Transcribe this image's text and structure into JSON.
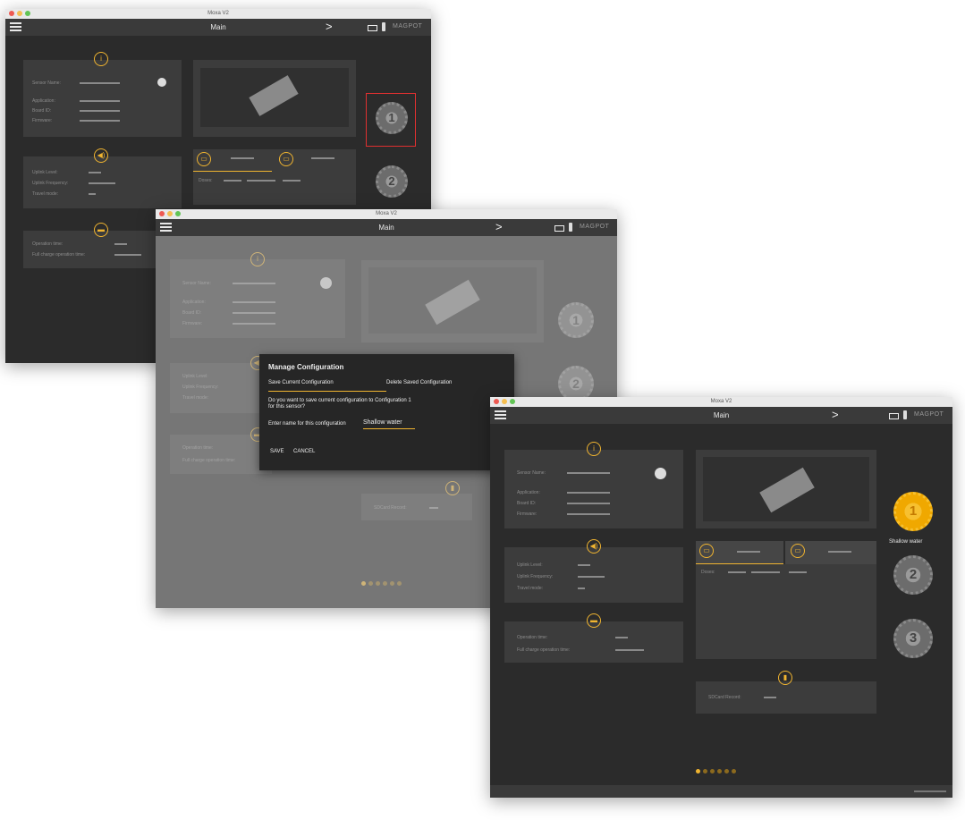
{
  "window": {
    "title": "Moxa V2"
  },
  "appbar": {
    "title": "Main",
    "brand": "MAGPOT"
  },
  "info": {
    "sensor_name": "Sensor Name:",
    "application": "Application:",
    "board_id": "Board ID:",
    "firmware": "Firmware:"
  },
  "uplink": {
    "level": "Uplink Level:",
    "frequency": "Uplink Frequency:",
    "travel_mode": "Travel mode:"
  },
  "power": {
    "operation_time": "Operation time:",
    "full_charge": "Full charge operation time:"
  },
  "channel": {
    "dose": "Doses:"
  },
  "sdcard": {
    "label": "SDCard Record:"
  },
  "configs": {
    "c1": "1",
    "c2": "2",
    "c3": "3",
    "c1_name": "Shallow water"
  },
  "dialog": {
    "title": "Manage Configuration",
    "tab_save": "Save Current Configuration",
    "tab_delete": "Delete Saved Configuration",
    "question": "Do you want to save current configuration to Configuration 1 for this sensor?",
    "name_label": "Enter name for this configuration",
    "name_value": "Shallow water",
    "save": "SAVE",
    "cancel": "CANCEL"
  },
  "colors": {
    "accent": "#f0b430",
    "background": "#2b2b2b",
    "panel": "#3c3c3c",
    "selection": "#e03030"
  },
  "icons": {
    "info": "info-icon",
    "signal": "signal-icon",
    "battery": "battery-icon",
    "sdcard": "sdcard-icon",
    "gear": "gear-icon",
    "menu": "hamburger-icon",
    "next": "chevron-right-icon"
  }
}
